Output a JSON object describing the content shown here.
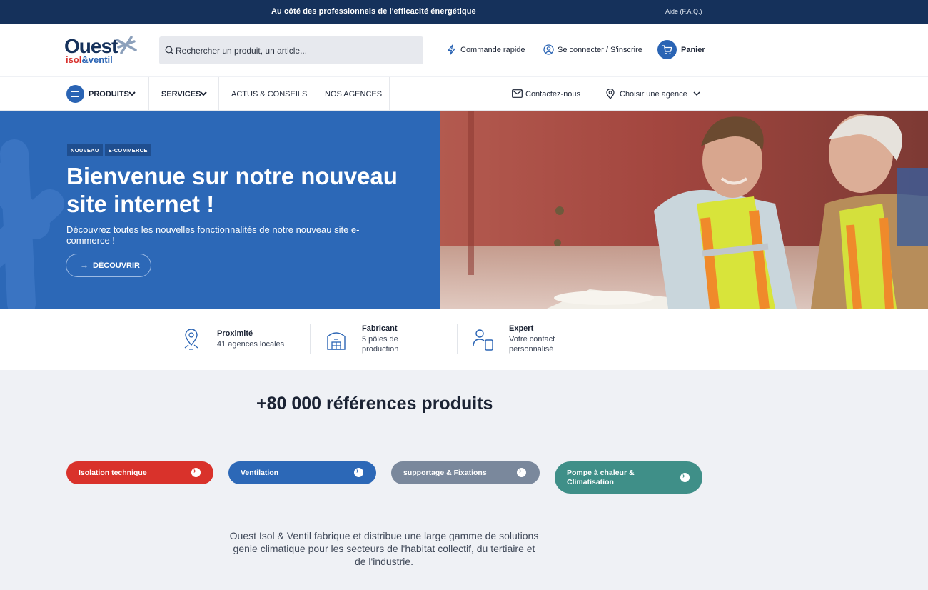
{
  "topbar": {
    "message": "Au côté des professionnels de l'efficacité énergétique",
    "help": "Aide (F.A.Q.)"
  },
  "logo": {
    "word1": "Ouest",
    "isol": "isol",
    "amp_ventil": "&ventil"
  },
  "search": {
    "placeholder": "Rechercher un produit, un article..."
  },
  "header": {
    "quick_order": "Commande rapide",
    "account": "Se connecter / S'inscrire",
    "cart": "Panier"
  },
  "nav": {
    "products": "PRODUITS",
    "services": "SERVICES",
    "news": "ACTUS & CONSEILS",
    "agencies": "NOS AGENCES",
    "contact": "Contactez-nous",
    "choose_agency": "Choisir une agence"
  },
  "hero": {
    "tags": [
      "NOUVEAU",
      "E-COMMERCE"
    ],
    "title": "Bienvenue sur notre nouveau site internet !",
    "subtitle": "Découvrez toutes les nouvelles fonctionnalités de notre nouveau site e-commerce !",
    "cta": "DÉCOUVRIR"
  },
  "features": [
    {
      "icon": "location-pin-icon",
      "title": "Proximité",
      "text": "41 agences locales"
    },
    {
      "icon": "factory-icon",
      "title": "Fabricant",
      "text": "5 pôles de production"
    },
    {
      "icon": "expert-user-icon",
      "title": "Expert",
      "text": "Votre contact personnalisé"
    }
  ],
  "references": {
    "title": "+80 000 références produits"
  },
  "categories": [
    {
      "label": "Isolation technique",
      "color": "#d9322b"
    },
    {
      "label": "Ventilation",
      "color": "#2c68b7"
    },
    {
      "label": "supportage & Fixations",
      "color": "#7a889c"
    },
    {
      "label": "Pompe à chaleur & Climatisation",
      "color": "#3f8f88"
    }
  ],
  "description": "Ouest Isol & Ventil fabrique et distribue une large gamme de solutions genie climatique pour les secteurs de l'habitat collectif, du tertiaire et de l'industrie.",
  "colors": {
    "navy": "#15315b",
    "primary": "#2c68b7",
    "red": "#d9322b"
  }
}
